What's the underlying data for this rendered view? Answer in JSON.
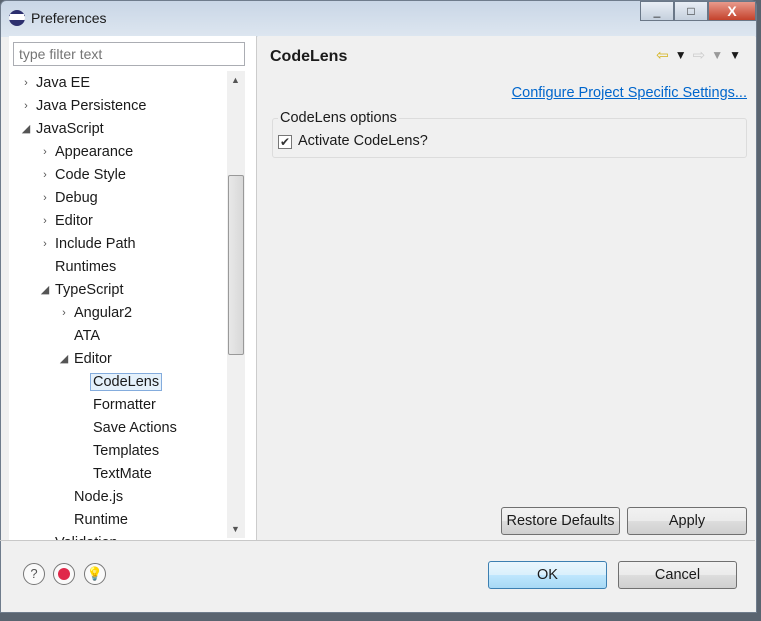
{
  "window": {
    "title": "Preferences",
    "minimize": "_",
    "maximize": "□",
    "close": "X"
  },
  "filter": {
    "placeholder": "type filter text"
  },
  "tree": [
    {
      "label": "Java EE",
      "level": 0,
      "arrow": "›"
    },
    {
      "label": "Java Persistence",
      "level": 0,
      "arrow": "›"
    },
    {
      "label": "JavaScript",
      "level": 0,
      "arrow": "◢"
    },
    {
      "label": "Appearance",
      "level": 1,
      "arrow": "›"
    },
    {
      "label": "Code Style",
      "level": 1,
      "arrow": "›"
    },
    {
      "label": "Debug",
      "level": 1,
      "arrow": "›"
    },
    {
      "label": "Editor",
      "level": 1,
      "arrow": "›"
    },
    {
      "label": "Include Path",
      "level": 1,
      "arrow": "›"
    },
    {
      "label": "Runtimes",
      "level": 1,
      "arrow": ""
    },
    {
      "label": "TypeScript",
      "level": 1,
      "arrow": "◢"
    },
    {
      "label": "Angular2",
      "level": 2,
      "arrow": "›"
    },
    {
      "label": "ATA",
      "level": 2,
      "arrow": ""
    },
    {
      "label": "Editor",
      "level": 2,
      "arrow": "◢"
    },
    {
      "label": "CodeLens",
      "level": 3,
      "arrow": "",
      "selected": true
    },
    {
      "label": "Formatter",
      "level": 3,
      "arrow": ""
    },
    {
      "label": "Save Actions",
      "level": 3,
      "arrow": ""
    },
    {
      "label": "Templates",
      "level": 3,
      "arrow": ""
    },
    {
      "label": "TextMate",
      "level": 3,
      "arrow": ""
    },
    {
      "label": "Node.js",
      "level": 2,
      "arrow": ""
    },
    {
      "label": "Runtime",
      "level": 2,
      "arrow": ""
    },
    {
      "label": "Validation",
      "level": 1,
      "arrow": ""
    }
  ],
  "page": {
    "title": "CodeLens",
    "link": "Configure Project Specific Settings...",
    "group_label": "CodeLens options",
    "checkbox_label": "Activate CodeLens?",
    "checkbox_checked": true,
    "restore": "Restore Defaults",
    "apply": "Apply"
  },
  "footer": {
    "ok": "OK",
    "cancel": "Cancel"
  },
  "colors": {
    "link": "#0066cc",
    "selection": "#e5f1fb"
  }
}
